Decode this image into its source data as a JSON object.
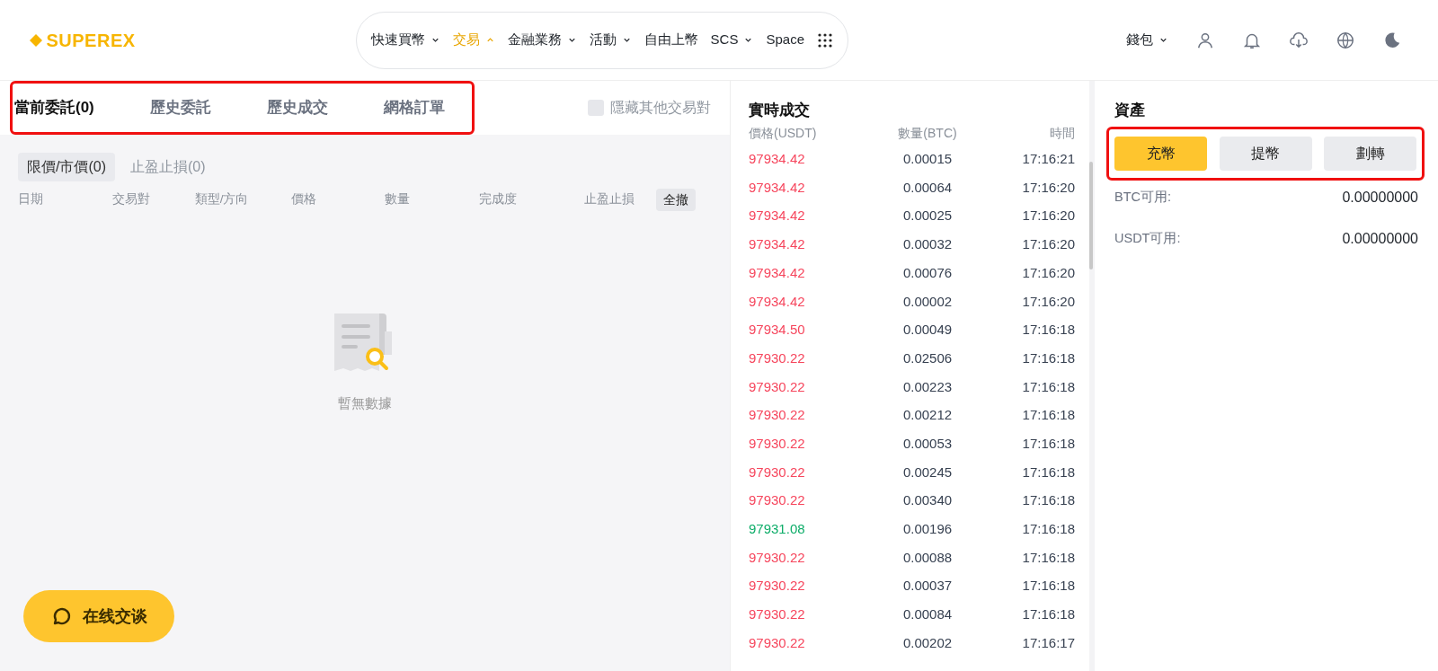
{
  "header": {
    "logo": "SUPEREX",
    "nav": [
      {
        "label": "快速買幣",
        "kind": "dropdown",
        "expanded": false,
        "selected": false
      },
      {
        "label": "交易",
        "kind": "dropdown",
        "expanded": true,
        "selected": true
      },
      {
        "label": "金融業務",
        "kind": "dropdown",
        "expanded": false,
        "selected": false
      },
      {
        "label": "活動",
        "kind": "dropdown",
        "expanded": false,
        "selected": false
      },
      {
        "label": "自由上幣",
        "kind": "link",
        "selected": false
      },
      {
        "label": "SCS",
        "kind": "dropdown",
        "expanded": false,
        "selected": false
      },
      {
        "label": "Space",
        "kind": "link",
        "selected": false
      }
    ],
    "wallet": "錢包"
  },
  "orders": {
    "highlighted": true,
    "tabs": [
      {
        "label": "當前委託(0)",
        "selected": true
      },
      {
        "label": "歷史委託",
        "selected": false
      },
      {
        "label": "歷史成交",
        "selected": false
      },
      {
        "label": "網格訂單",
        "selected": false
      }
    ],
    "hide_others": {
      "label": "隱藏其他交易對",
      "checked": false
    },
    "subtabs": [
      {
        "label": "限價/市價(0)",
        "selected": true
      },
      {
        "label": "止盈止損(0)",
        "selected": false
      }
    ],
    "columns": [
      "日期",
      "交易對",
      "類型/方向",
      "價格",
      "數量",
      "完成度",
      "止盈止損"
    ],
    "cancel_all": "全撤",
    "empty_text": "暫無數據"
  },
  "chat_button": "在线交谈",
  "trades": {
    "title": "實時成交",
    "columns": [
      "價格(USDT)",
      "數量(BTC)",
      "時間"
    ],
    "rows": [
      {
        "price": "97934.42",
        "amount": "0.00015",
        "time": "17:16:21",
        "kind": "sell"
      },
      {
        "price": "97934.42",
        "amount": "0.00064",
        "time": "17:16:20",
        "kind": "sell"
      },
      {
        "price": "97934.42",
        "amount": "0.00025",
        "time": "17:16:20",
        "kind": "sell"
      },
      {
        "price": "97934.42",
        "amount": "0.00032",
        "time": "17:16:20",
        "kind": "sell"
      },
      {
        "price": "97934.42",
        "amount": "0.00076",
        "time": "17:16:20",
        "kind": "sell"
      },
      {
        "price": "97934.42",
        "amount": "0.00002",
        "time": "17:16:20",
        "kind": "sell"
      },
      {
        "price": "97934.50",
        "amount": "0.00049",
        "time": "17:16:18",
        "kind": "sell"
      },
      {
        "price": "97930.22",
        "amount": "0.02506",
        "time": "17:16:18",
        "kind": "sell"
      },
      {
        "price": "97930.22",
        "amount": "0.00223",
        "time": "17:16:18",
        "kind": "sell"
      },
      {
        "price": "97930.22",
        "amount": "0.00212",
        "time": "17:16:18",
        "kind": "sell"
      },
      {
        "price": "97930.22",
        "amount": "0.00053",
        "time": "17:16:18",
        "kind": "sell"
      },
      {
        "price": "97930.22",
        "amount": "0.00245",
        "time": "17:16:18",
        "kind": "sell"
      },
      {
        "price": "97930.22",
        "amount": "0.00340",
        "time": "17:16:18",
        "kind": "sell"
      },
      {
        "price": "97931.08",
        "amount": "0.00196",
        "time": "17:16:18",
        "kind": "buy"
      },
      {
        "price": "97930.22",
        "amount": "0.00088",
        "time": "17:16:18",
        "kind": "sell"
      },
      {
        "price": "97930.22",
        "amount": "0.00037",
        "time": "17:16:18",
        "kind": "sell"
      },
      {
        "price": "97930.22",
        "amount": "0.00084",
        "time": "17:16:18",
        "kind": "sell"
      },
      {
        "price": "97930.22",
        "amount": "0.00202",
        "time": "17:16:17",
        "kind": "sell"
      }
    ]
  },
  "assets": {
    "title": "資產",
    "highlighted": true,
    "buttons": [
      {
        "label": "充幣",
        "selected": true
      },
      {
        "label": "提幣",
        "selected": false
      },
      {
        "label": "劃轉",
        "selected": false
      }
    ],
    "balances": [
      {
        "label": "BTC可用:",
        "value": "0.00000000"
      },
      {
        "label": "USDT可用:",
        "value": "0.00000000"
      }
    ]
  }
}
